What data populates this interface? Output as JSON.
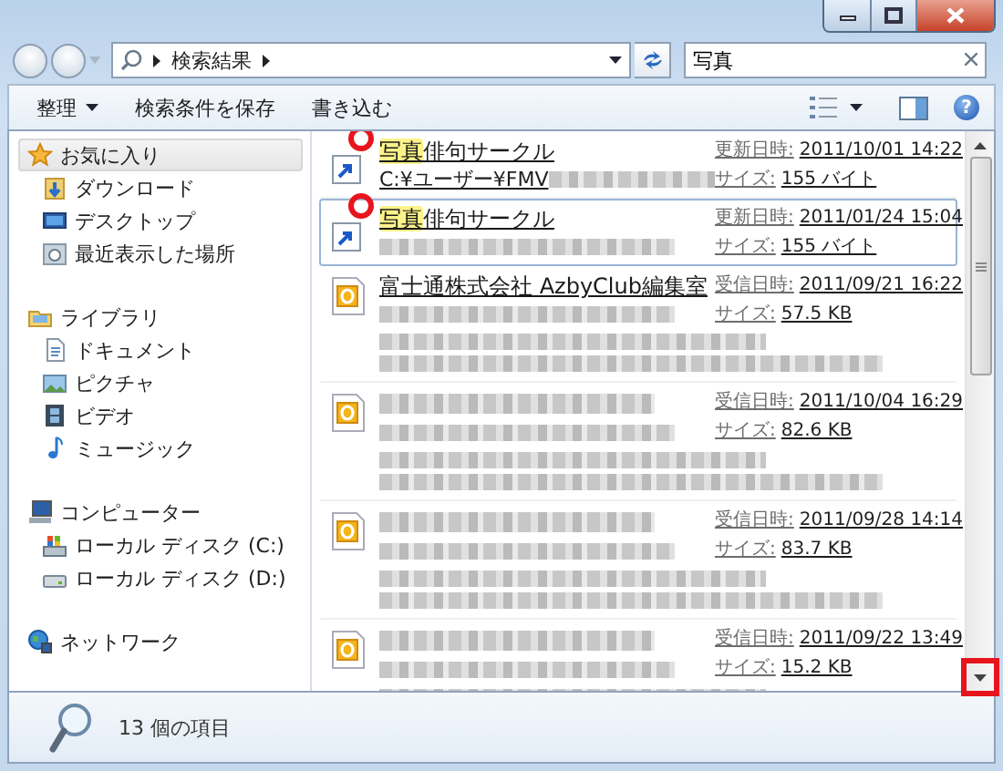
{
  "address": {
    "crumbs": [
      "検索結果"
    ],
    "search": {
      "value": "写真"
    }
  },
  "toolbar": {
    "buttons": [
      {
        "label": "整理",
        "dropdown": true
      },
      {
        "label": "検索条件を保存",
        "dropdown": false
      },
      {
        "label": "書き込む",
        "dropdown": false
      }
    ],
    "help_glyph": "?"
  },
  "sidebar": {
    "groups": [
      {
        "label": "お気に入り",
        "kind": "favorites",
        "selected": true,
        "children": [
          {
            "label": "ダウンロード",
            "kind": "download",
            "selected": false
          },
          {
            "label": "デスクトップ",
            "kind": "desktop",
            "selected": false
          },
          {
            "label": "最近表示した場所",
            "kind": "recent",
            "selected": false
          }
        ]
      },
      {
        "label": "ライブラリ",
        "kind": "library",
        "selected": false,
        "children": [
          {
            "label": "ドキュメント",
            "kind": "document",
            "selected": false
          },
          {
            "label": "ピクチャ",
            "kind": "picture",
            "selected": false
          },
          {
            "label": "ビデオ",
            "kind": "video",
            "selected": false
          },
          {
            "label": "ミュージック",
            "kind": "music",
            "selected": false
          }
        ]
      },
      {
        "label": "コンピューター",
        "kind": "computer",
        "selected": false,
        "children": [
          {
            "label": "ローカル ディスク (C:)",
            "kind": "system-disk",
            "selected": false
          },
          {
            "label": "ローカル ディスク (D:)",
            "kind": "disk",
            "selected": false
          }
        ]
      },
      {
        "label": "ネットワーク",
        "kind": "network",
        "selected": false
      }
    ]
  },
  "results": [
    {
      "kind": "shortcut",
      "selected": false,
      "annotated": true,
      "title": [
        {
          "text": "写真",
          "highlighted": true
        },
        {
          "text": "俳句サークル",
          "highlighted": false
        }
      ],
      "path": "C:¥ユーザー¥FMV",
      "meta": [
        {
          "label": "更新日時:",
          "value": "2011/10/01 14:22"
        },
        {
          "label": "サイズ:",
          "value": "155 バイト"
        }
      ]
    },
    {
      "kind": "shortcut",
      "selected": true,
      "annotated": true,
      "title": [
        {
          "text": "写真",
          "highlighted": true
        },
        {
          "text": "俳句サークル",
          "highlighted": false
        }
      ],
      "meta": [
        {
          "label": "更新日時:",
          "value": "2011/01/24 15:04"
        },
        {
          "label": "サイズ:",
          "value": "155 バイト"
        }
      ]
    },
    {
      "kind": "mail",
      "selected": false,
      "annotated": false,
      "title": [
        {
          "text": "富士通株式会社 AzbyClub編集室",
          "highlighted": false
        }
      ],
      "meta": [
        {
          "label": "受信日時:",
          "value": "2011/09/21 16:22"
        },
        {
          "label": "サイズ:",
          "value": "57.5 KB"
        }
      ]
    },
    {
      "kind": "mail",
      "selected": false,
      "annotated": false,
      "meta": [
        {
          "label": "受信日時:",
          "value": "2011/10/04 16:29"
        },
        {
          "label": "サイズ:",
          "value": "82.6 KB"
        }
      ]
    },
    {
      "kind": "mail",
      "selected": false,
      "annotated": false,
      "meta": [
        {
          "label": "受信日時:",
          "value": "2011/09/28 14:14"
        },
        {
          "label": "サイズ:",
          "value": "83.7 KB"
        }
      ]
    },
    {
      "kind": "mail",
      "selected": false,
      "annotated": false,
      "meta": [
        {
          "label": "受信日時:",
          "value": "2011/09/22 13:49"
        },
        {
          "label": "サイズ:",
          "value": "15.2 KB"
        }
      ]
    }
  ],
  "scrollbar": {
    "down_arrow_annotated": true
  },
  "status_bar": {
    "count": "13 個の項目"
  }
}
